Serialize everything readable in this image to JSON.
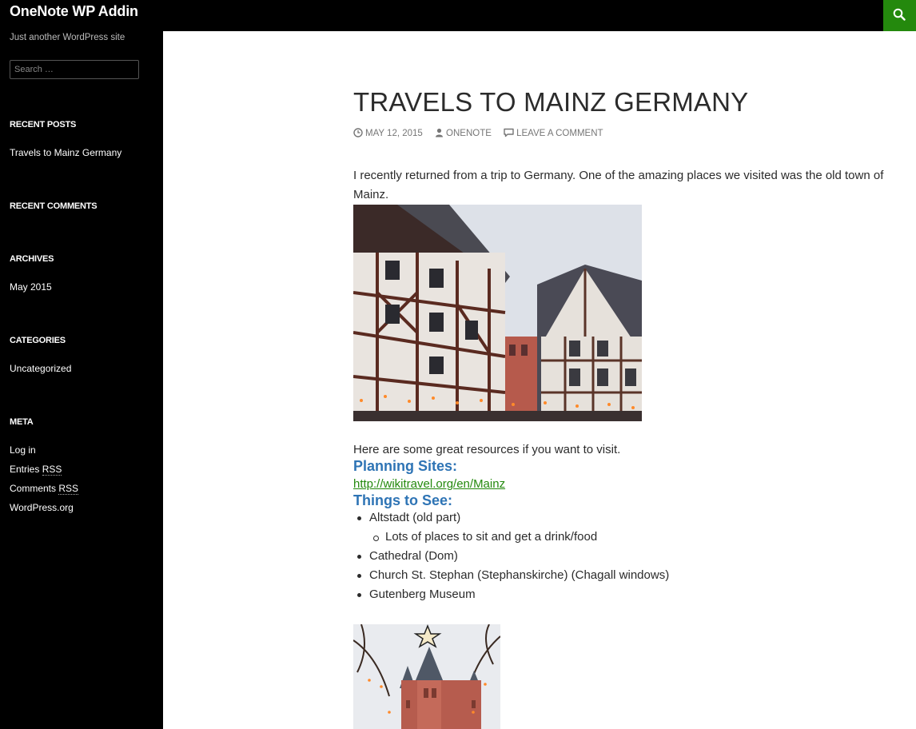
{
  "header": {
    "site_title": "OneNote WP Addin",
    "search_icon": "search-icon"
  },
  "sidebar": {
    "tagline": "Just another WordPress site",
    "search_placeholder": "Search …",
    "recent_posts": {
      "title": "RECENT POSTS",
      "items": [
        "Travels to Mainz Germany"
      ]
    },
    "recent_comments": {
      "title": "RECENT COMMENTS"
    },
    "archives": {
      "title": "ARCHIVES",
      "items": [
        "May 2015"
      ]
    },
    "categories": {
      "title": "CATEGORIES",
      "items": [
        "Uncategorized"
      ]
    },
    "meta": {
      "title": "META",
      "items": [
        "Log in",
        "Entries ",
        "RSS",
        "Comments ",
        "RSS",
        "WordPress.org"
      ]
    }
  },
  "post": {
    "title": "TRAVELS TO MAINZ GERMANY",
    "date": "MAY 12, 2015",
    "author": "ONENOTE",
    "comment_link": "LEAVE A COMMENT",
    "intro": "I recently returned from a trip to Germany. One of the amazing places we visited was the old town of Mainz.",
    "resources_text": "Here are some great resources if you want to visit.",
    "planning_heading": "Planning Sites:",
    "planning_link": "http://wikitravel.org/en/Mainz",
    "things_heading": "Things to See:",
    "things": [
      "Altstadt (old part)",
      "Lots of places to sit and get a drink/food",
      "Cathedral (Dom)",
      "Church St. Stephan (Stephanskirche) (Chagall windows)",
      "Gutenberg Museum"
    ]
  },
  "colors": {
    "accent_green": "#24890d",
    "heading_blue": "#2e74b5",
    "sidebar_bg": "#000000"
  }
}
